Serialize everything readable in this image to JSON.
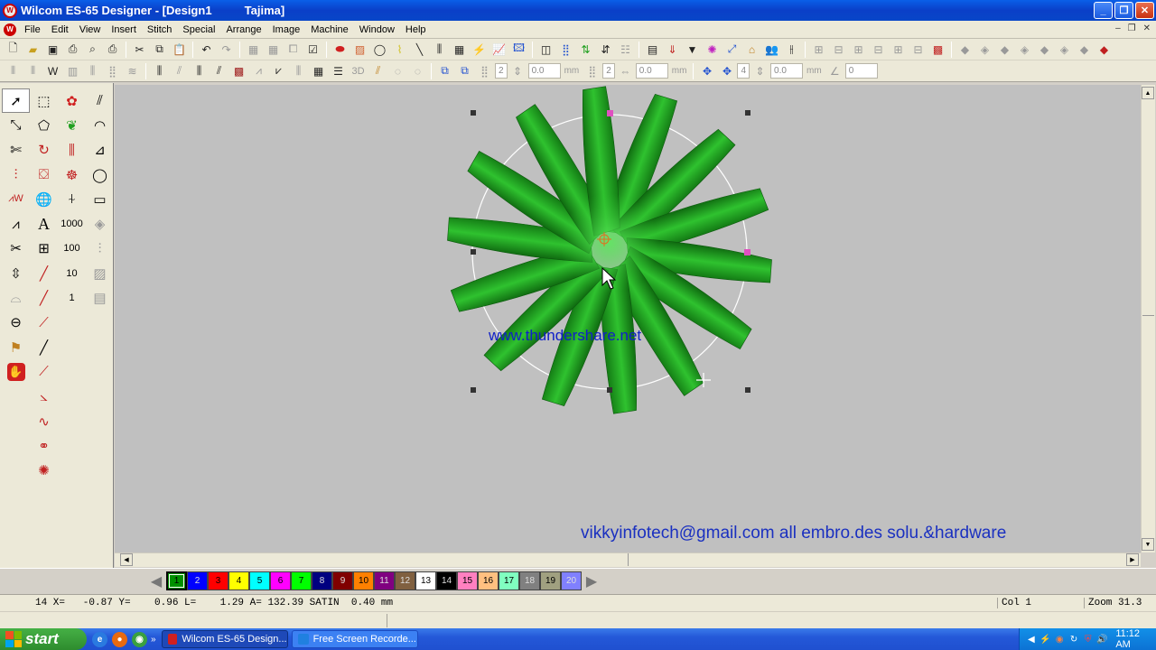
{
  "window": {
    "title": "Wilcom ES-65 Designer - [Design1          Tajima]",
    "app_icon": "W"
  },
  "menu": [
    "File",
    "Edit",
    "View",
    "Insert",
    "Stitch",
    "Special",
    "Arrange",
    "Image",
    "Machine",
    "Window",
    "Help"
  ],
  "toolbar2_fields": {
    "v1": "2",
    "v2": "0.0",
    "u2": "mm",
    "v3": "2",
    "v4": "0.0",
    "u4": "mm",
    "v5": "4",
    "v6": "0.0",
    "u6": "mm",
    "v7": "0"
  },
  "left_tool_numbers": {
    "n1": "1000",
    "n2": "100",
    "n3": "10",
    "n4": "1"
  },
  "left_tool_text_a": "A",
  "canvas": {
    "watermark": "www.thundershare.net",
    "email_note": "vikkyinfotech@gmail.com all embro.des solu.&hardware"
  },
  "palette": [
    {
      "label": "1",
      "color": "#009000"
    },
    {
      "label": "2",
      "color": "#0000ff"
    },
    {
      "label": "3",
      "color": "#ff0000"
    },
    {
      "label": "4",
      "color": "#ffff00"
    },
    {
      "label": "5",
      "color": "#00ffff"
    },
    {
      "label": "6",
      "color": "#ff00ff"
    },
    {
      "label": "7",
      "color": "#00ff00"
    },
    {
      "label": "8",
      "color": "#000080"
    },
    {
      "label": "9",
      "color": "#800000"
    },
    {
      "label": "10",
      "color": "#ff8000"
    },
    {
      "label": "11",
      "color": "#800080"
    },
    {
      "label": "12",
      "color": "#806040"
    },
    {
      "label": "13",
      "color": "#ffffff"
    },
    {
      "label": "14",
      "color": "#000000"
    },
    {
      "label": "15",
      "color": "#ff80c0"
    },
    {
      "label": "16",
      "color": "#ffc080"
    },
    {
      "label": "17",
      "color": "#80ffc0"
    },
    {
      "label": "18",
      "color": "#808080"
    },
    {
      "label": "19",
      "color": "#a0a080"
    },
    {
      "label": "20",
      "color": "#8080ff"
    }
  ],
  "status": {
    "main": "14 X=   -0.87 Y=    0.96 L=    1.29 A= 132.39 SATIN  0.40 mm",
    "col": "Col 1",
    "zoom": "Zoom 31.3"
  },
  "taskbar": {
    "start": "start",
    "tasks": [
      {
        "label": "Wilcom ES-65 Design...",
        "icon_color": "#d02020"
      },
      {
        "label": "Free Screen Recorde...",
        "icon_color": "#2080e0"
      }
    ],
    "clock": "11:12 AM"
  },
  "design": {
    "petals": 14,
    "thread_color": "#1f9a1f",
    "selection_circle": "white"
  }
}
